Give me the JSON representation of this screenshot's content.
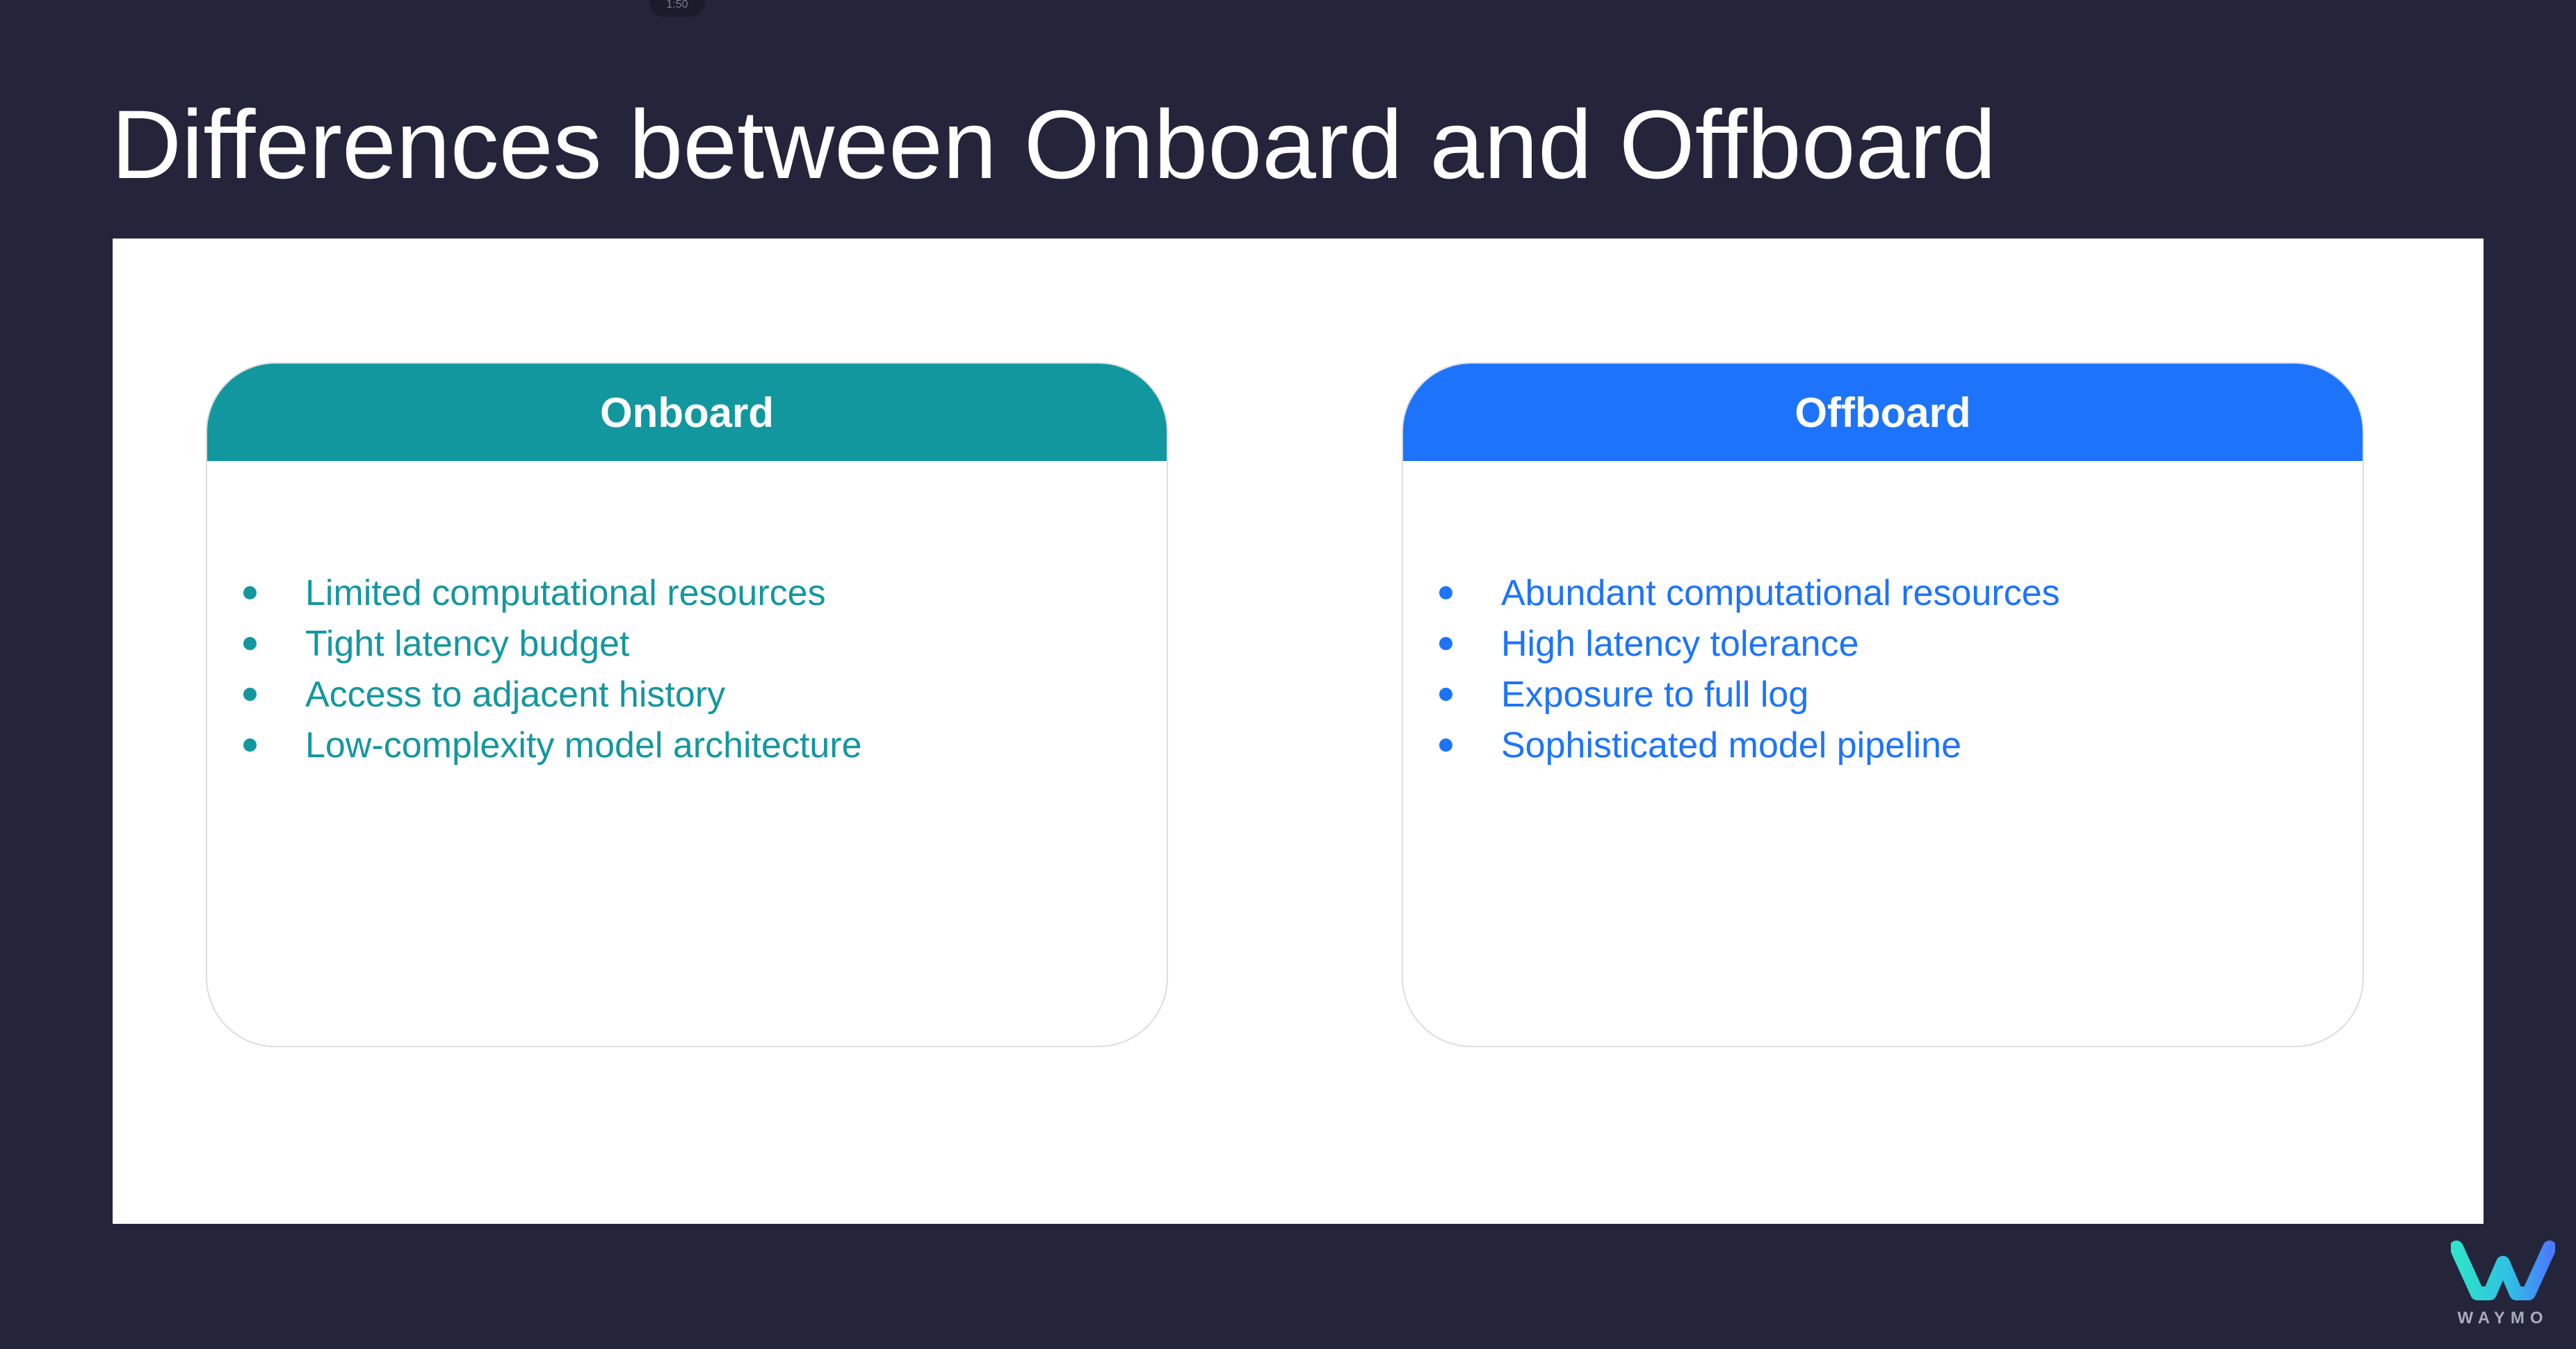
{
  "theme": {
    "background": "#24243b",
    "onboard_accent": "#13979f",
    "offboard_accent": "#1d74fb"
  },
  "top_indicator": "1:50",
  "slide": {
    "title": "Differences between Onboard and Offboard"
  },
  "cards": [
    {
      "heading": "Onboard",
      "items": [
        "Limited computational resources",
        "Tight latency budget",
        "Access to adjacent history",
        "Low-complexity model architecture"
      ]
    },
    {
      "heading": "Offboard",
      "items": [
        "Abundant computational resources",
        "High latency tolerance",
        "Exposure to full log",
        "Sophisticated model pipeline"
      ]
    }
  ],
  "logo": {
    "icon": "waymo-logo-icon",
    "word": "WAYMO"
  }
}
